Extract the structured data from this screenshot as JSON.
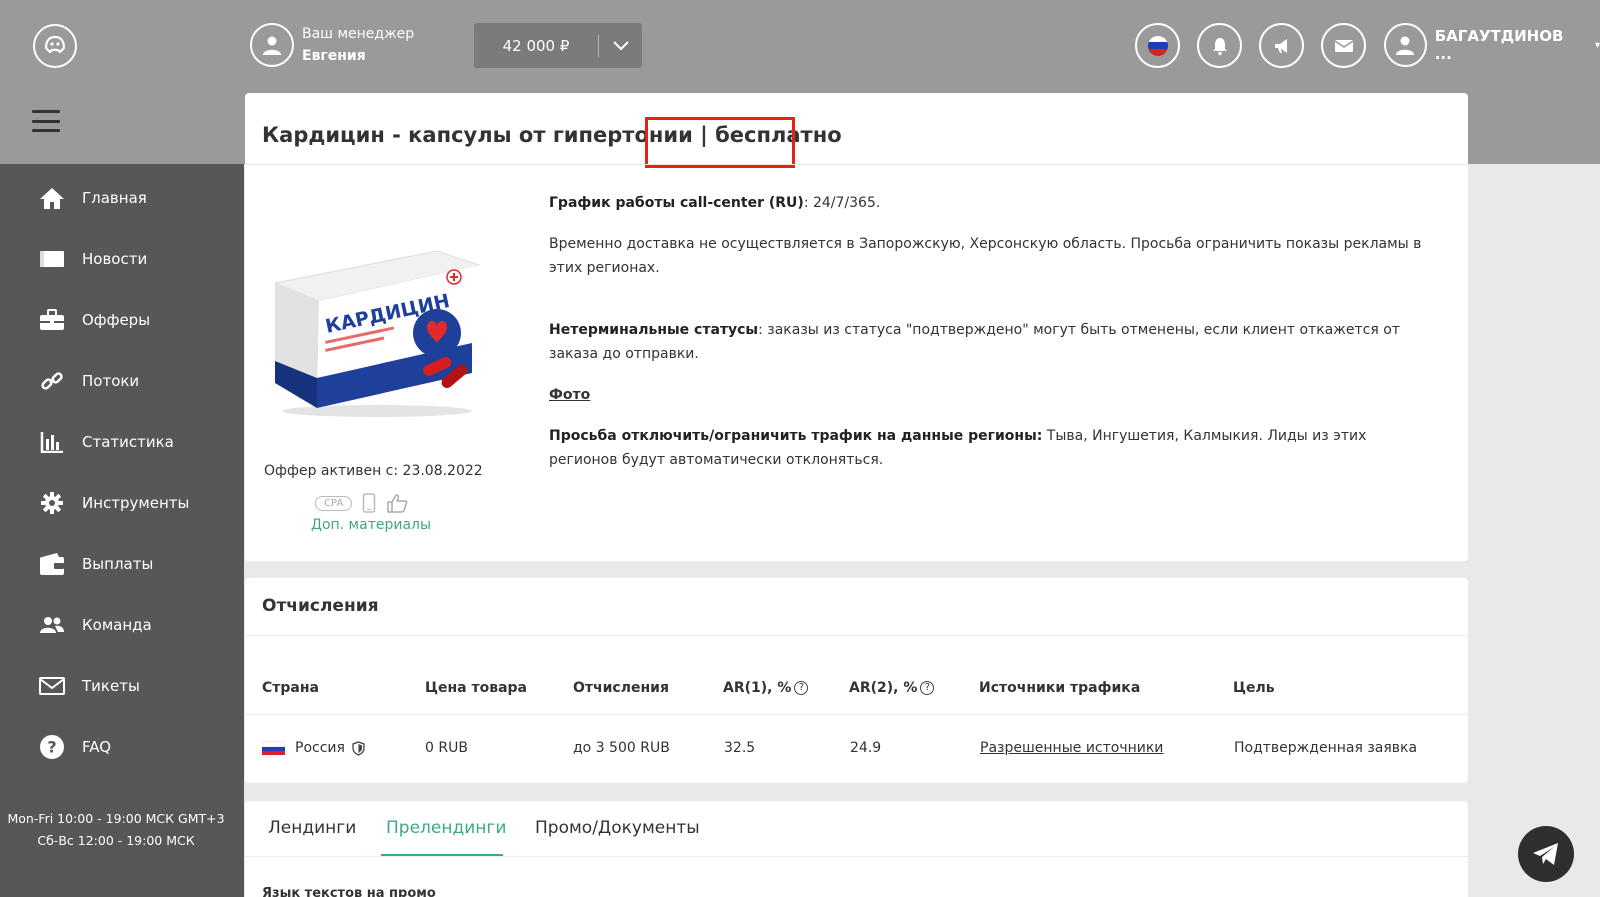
{
  "header": {
    "manager_label": "Ваш менеджер",
    "manager_name": "Евгения",
    "balance": "42 000 ₽",
    "user_name": "БАГАУТДИНОВ ...",
    "icons": [
      "logo-icon",
      "avatar-icon",
      "chevron-down-icon",
      "flag-ru-icon",
      "bell-icon",
      "megaphone-icon",
      "mail-icon",
      "user-icon"
    ]
  },
  "sidebar": {
    "items": [
      {
        "label": "Главная",
        "icon": "home-icon"
      },
      {
        "label": "Новости",
        "icon": "news-icon"
      },
      {
        "label": "Офферы",
        "icon": "briefcase-icon"
      },
      {
        "label": "Потоки",
        "icon": "link-icon"
      },
      {
        "label": "Статистика",
        "icon": "bar-chart-icon"
      },
      {
        "label": "Инструменты",
        "icon": "gear-icon"
      },
      {
        "label": "Выплаты",
        "icon": "wallet-icon"
      },
      {
        "label": "Команда",
        "icon": "team-icon"
      },
      {
        "label": "Тикеты",
        "icon": "envelope-icon"
      },
      {
        "label": "FAQ",
        "icon": "question-icon"
      }
    ],
    "hours_line1": "Mon-Fri 10:00 - 19:00 МСК GMT+3",
    "hours_line2": "Сб-Вс 12:00 - 19:00 МСК"
  },
  "offer": {
    "title": "Кардицин - капсулы от гипертонии",
    "title_suffix": "| бесплатно",
    "product_brand": "КАРДИЦИН",
    "active_since": "Оффер активен с: 23.08.2022",
    "badge_cpa": "CPA",
    "extra_materials": "Доп. материалы",
    "desc": {
      "p1_bold": "График работы call-center (RU)",
      "p1_text": ": 24/7/365.",
      "p2_text": "Временно доставка не осуществляется в Запорожскую, Херсонскую область. Просьба ограничить показы рекламы в этих регионах.",
      "p3_bold": "Нетерминальные статусы",
      "p3_text": ": заказы из статуса \"подтверждено\" могут быть отменены, если клиент откажется от заказа до отправки.",
      "p4_link": "Фото",
      "p5_bold": "Просьба отключить/ограничить трафик на данные регионы:",
      "p5_text": " Тыва, Ингушетия, Калмыкия. Лиды из этих регионов будут автоматически отклоняться."
    }
  },
  "payouts": {
    "title": "Отчисления",
    "headers": [
      "Страна",
      "Цена товара",
      "Отчисления",
      "AR(1), %",
      "AR(2), %",
      "Источники трафика",
      "Цель"
    ],
    "row": {
      "country": "Россия",
      "price": "0 RUB",
      "payout": "до 3 500 RUB",
      "ar1": "32.5",
      "ar2": "24.9",
      "sources": "Разрешенные источники",
      "goal": "Подтвержденная заявка"
    }
  },
  "tabs": {
    "items": [
      "Лендинги",
      "Прелендинги",
      "Промо/Документы"
    ],
    "active": "Прелендинги",
    "sub_label": "Язык текстов на промо"
  },
  "colors": {
    "accent": "#3fa78a",
    "highlight": "#e2231a",
    "sidebar": "#575757",
    "topbar": "#9a9a9a"
  }
}
